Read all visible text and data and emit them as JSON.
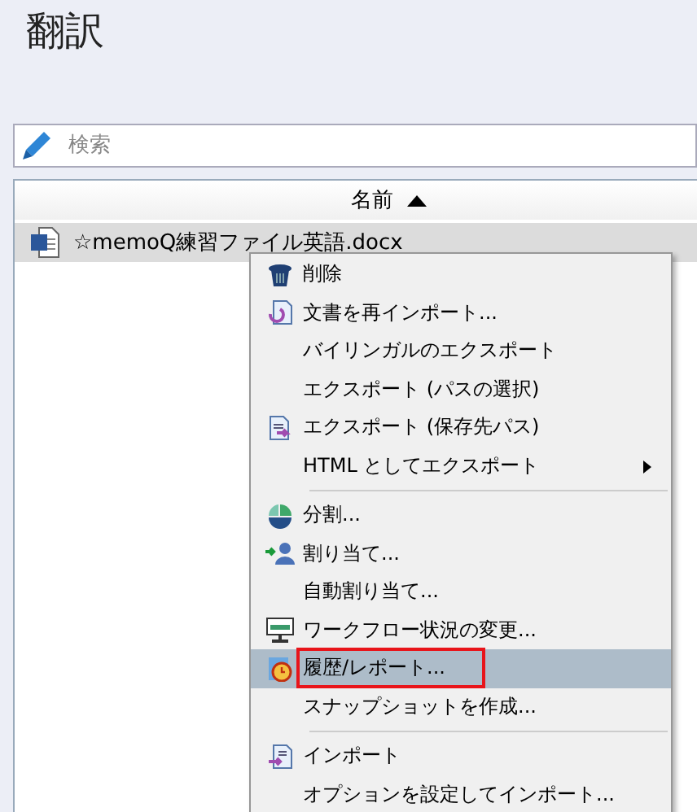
{
  "title": "翻訳",
  "search": {
    "placeholder": "検索"
  },
  "table": {
    "columns": [
      {
        "label": "名前"
      }
    ],
    "rows": [
      {
        "name": "☆memoQ練習ファイル英語.docx",
        "selected": true
      }
    ]
  },
  "context_menu": {
    "items": [
      {
        "kind": "item",
        "label": "削除",
        "submenu": false,
        "selected": false,
        "marked": false
      },
      {
        "kind": "item",
        "label": "文書を再インポート...",
        "submenu": false,
        "selected": false,
        "marked": false
      },
      {
        "kind": "item",
        "label": "バイリンガルのエクスポート",
        "submenu": false,
        "selected": false,
        "marked": false
      },
      {
        "kind": "item",
        "label": "エクスポート (パスの選択)",
        "submenu": false,
        "selected": false,
        "marked": false
      },
      {
        "kind": "item",
        "label": "エクスポート (保存先パス)",
        "submenu": false,
        "selected": false,
        "marked": false
      },
      {
        "kind": "item",
        "label": "HTML としてエクスポート",
        "submenu": true,
        "selected": false,
        "marked": false
      },
      {
        "kind": "separator"
      },
      {
        "kind": "item",
        "label": "分割...",
        "submenu": false,
        "selected": false,
        "marked": false
      },
      {
        "kind": "item",
        "label": "割り当て...",
        "submenu": false,
        "selected": false,
        "marked": false
      },
      {
        "kind": "item",
        "label": "自動割り当て...",
        "submenu": false,
        "selected": false,
        "marked": false
      },
      {
        "kind": "item",
        "label": "ワークフロー状況の変更...",
        "submenu": false,
        "selected": false,
        "marked": false
      },
      {
        "kind": "item",
        "label": "履歴/レポート...",
        "submenu": false,
        "selected": true,
        "marked": true
      },
      {
        "kind": "item",
        "label": "スナップショットを作成...",
        "submenu": false,
        "selected": false,
        "marked": false
      },
      {
        "kind": "separator"
      },
      {
        "kind": "item",
        "label": "インポート",
        "submenu": false,
        "selected": false,
        "marked": false
      },
      {
        "kind": "item",
        "label": "オプションを設定してインポート...",
        "submenu": false,
        "selected": false,
        "marked": false
      }
    ]
  }
}
